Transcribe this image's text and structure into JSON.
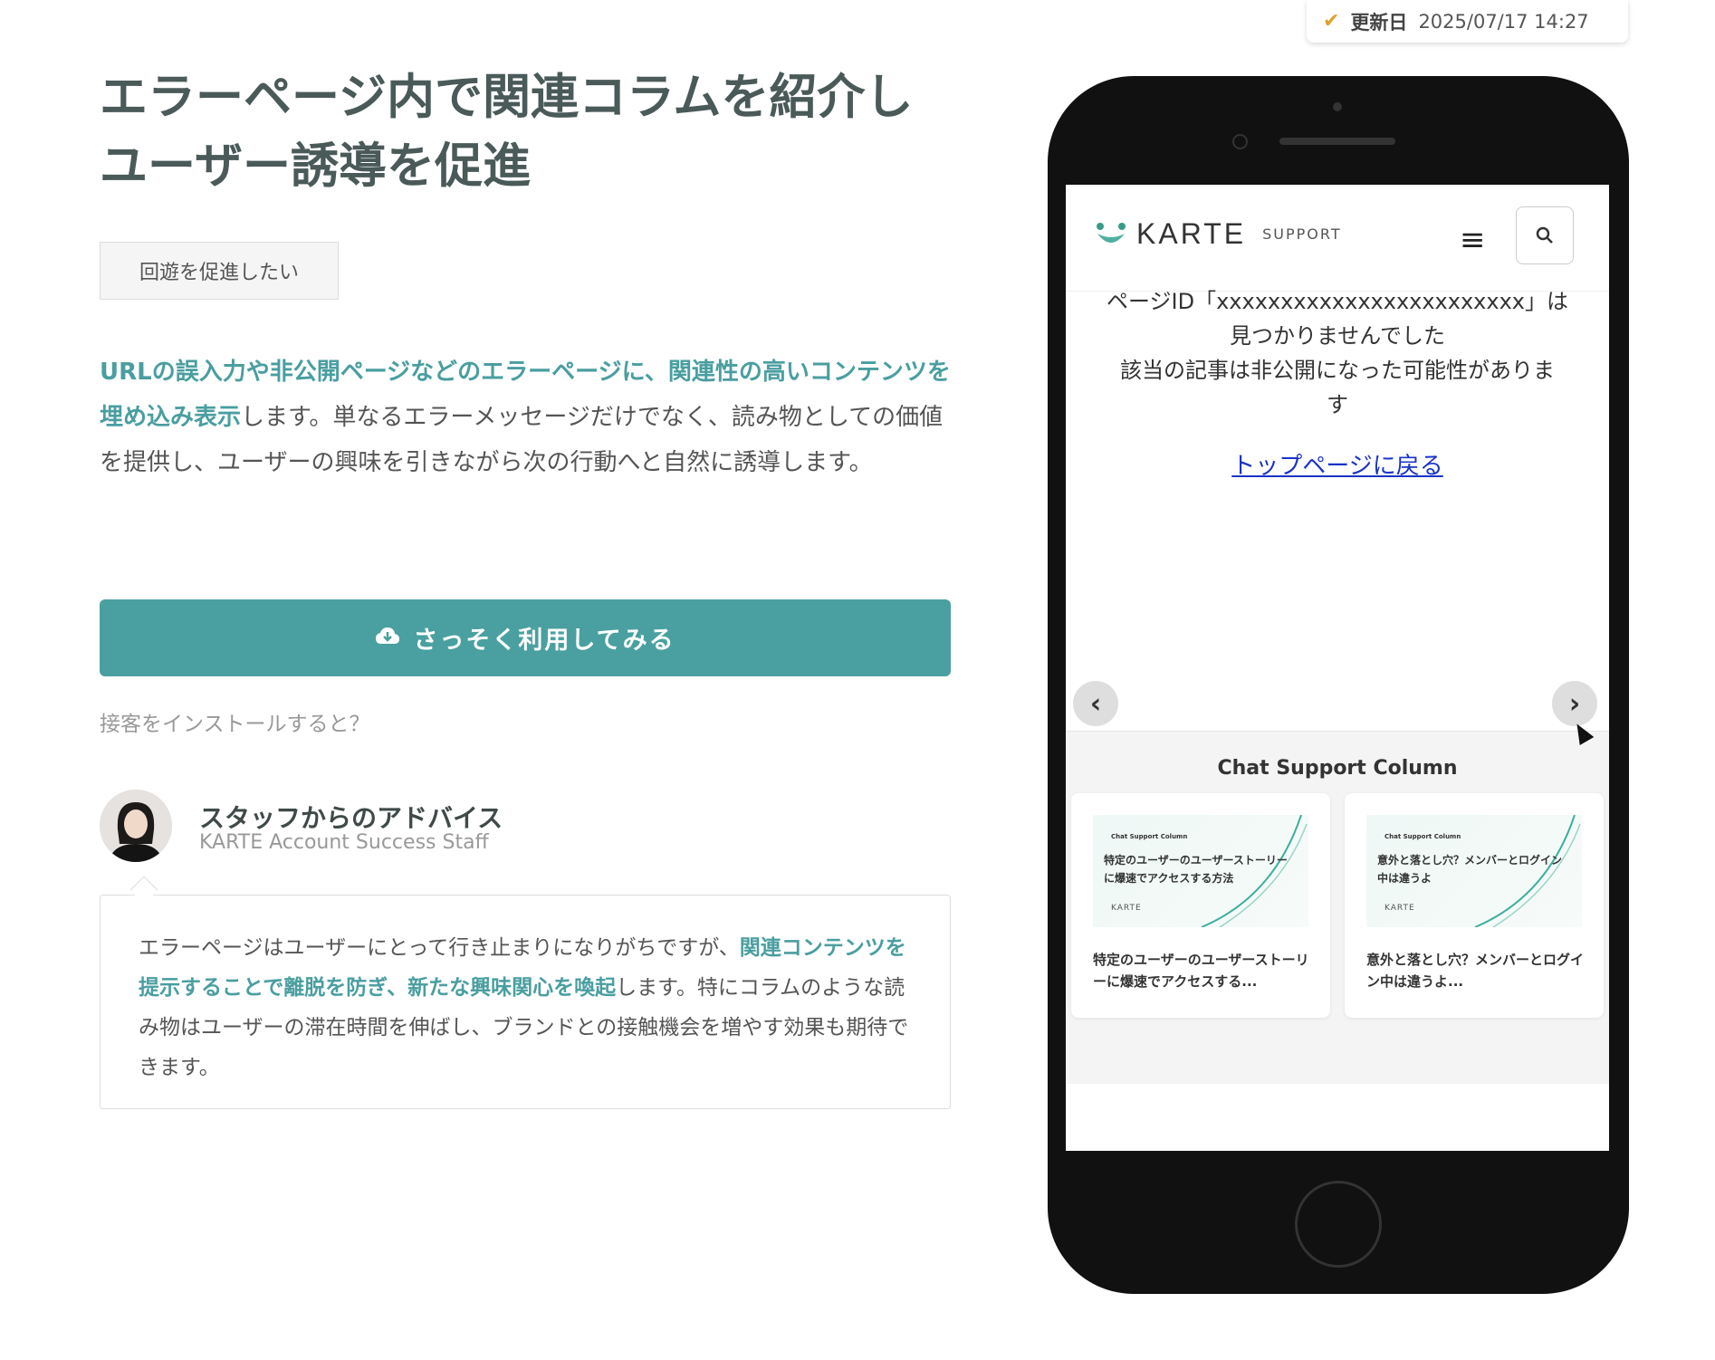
{
  "updated": {
    "label": "更新日",
    "value": "2025/07/17  14:27"
  },
  "title": "エラーページ内で関連コラムを紹介しユーザー誘導を促進",
  "tag": "回遊を促進したい",
  "description": {
    "highlight": "URLの誤入力や非公開ページなどのエラーページに、関連性の高いコンテンツを埋め込み表示",
    "rest": "します。単なるエラーメッセージだけでなく、読み物としての価値を提供し、ユーザーの興味を引きながら次の行動へと自然に誘導します。"
  },
  "cta": {
    "label": "さっそく利用してみる",
    "icon": "cloud-download-icon"
  },
  "install_link": "接客をインストールすると？",
  "advice": {
    "title": "スタッフからのアドバイス",
    "subtitle": "KARTE Account Success Staff",
    "text_before": "エラーページはユーザーにとって行き止まりになりがちですが、",
    "highlight": "関連コンテンツを提示することで離脱を防ぎ、新たな興味関心を喚起",
    "text_after": "します。特にコラムのような読み物はユーザーの滞在時間を伸ばし、ブランドとの接触機会を増やす効果も期待できます。"
  },
  "phone": {
    "brand": "KARTE",
    "brand_sub": "SUPPORT",
    "error_line1": "ページID「xxxxxxxxxxxxxxxxxxxxxxxx」は",
    "error_line2": "見つかりませんでした",
    "error_line3": "該当の記事は非公開になった可能性がありま",
    "error_line4": "す",
    "top_link": "トップページに戻る",
    "column_title": "Chat Support Column",
    "cards": [
      {
        "thumb_caption": "Chat Support Column",
        "thumb_text": "特定のユーザーのユーザーストーリーに爆速でアクセスする方法",
        "thumb_logo": "KARTE",
        "name": "特定のユーザーのユーザーストーリーに爆速でアクセスする..."
      },
      {
        "thumb_caption": "Chat Support Column",
        "thumb_text": "意外と落とし穴？メンバーとログイン中は違うよ",
        "thumb_logo": "KARTE",
        "name": "意外と落とし穴？メンバーとログイン中は違うよ..."
      }
    ]
  },
  "colors": {
    "accent": "#4aa0a0",
    "title": "#4a5a59",
    "link": "#1a33c7",
    "check": "#e0a030"
  }
}
